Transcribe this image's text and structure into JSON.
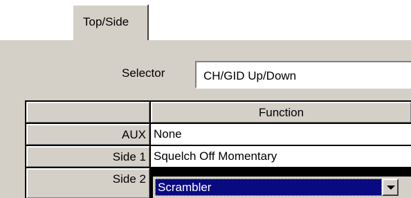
{
  "tabs": [
    {
      "label": "Top/Side",
      "active": true
    }
  ],
  "selector": {
    "label": "Selector",
    "value": "CH/GID Up/Down"
  },
  "grid": {
    "column_header": "Function",
    "rows": [
      {
        "label": "AUX",
        "function": "None"
      },
      {
        "label": "Side 1",
        "function": "Squelch Off Momentary"
      },
      {
        "label": "Side 2",
        "function": "Scrambler"
      }
    ]
  },
  "editor": {
    "selected_value": "Scrambler",
    "dropdown_icon": "chevron-down-icon"
  },
  "colors": {
    "panel": "#d4d0c8",
    "selection": "#0a0a80"
  }
}
